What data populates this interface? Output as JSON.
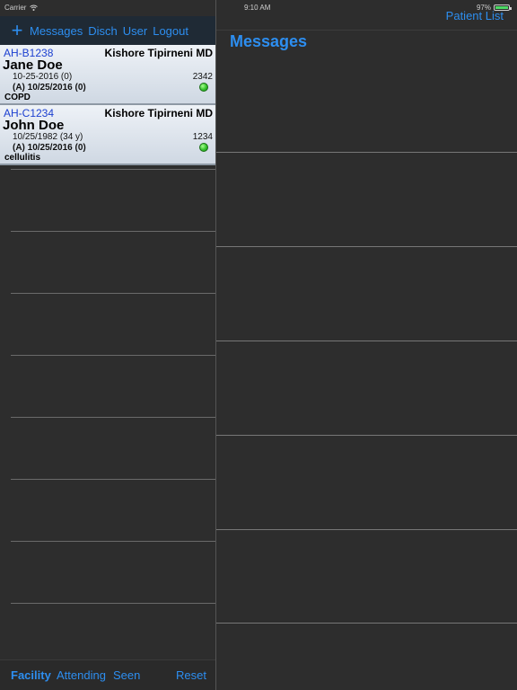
{
  "status_bar": {
    "carrier": "Carrier",
    "time": "9:10 AM",
    "battery": "97%",
    "battery_level": 0.97
  },
  "left_nav": {
    "add_icon": "plus-icon",
    "items": [
      "Messages",
      "Disch",
      "User",
      "Logout"
    ]
  },
  "patients": [
    {
      "id": "AH-B1238",
      "doctor": "Kishore Tipirneni MD",
      "name": "Jane Doe",
      "dob": "10-25-2016 (0)",
      "number": "2342",
      "admit": "(A)  10/25/2016 (0)",
      "diagnosis": "COPD",
      "status_color": "#36c22c"
    },
    {
      "id": "AH-C1234",
      "doctor": "Kishore Tipirneni MD",
      "name": "John Doe",
      "dob": "10/25/1982 (34 y)",
      "number": "1234",
      "admit": "(A)  10/25/2016 (0)",
      "diagnosis": "cellulitis",
      "status_color": "#36c22c"
    }
  ],
  "left_toolbar": {
    "facility": "Facility",
    "attending": "Attending",
    "seen": "Seen",
    "reset": "Reset"
  },
  "right_nav": {
    "patient_list": "Patient List",
    "title": "Messages"
  },
  "colors": {
    "accent": "#2d8ef0",
    "background": "#2d2d2d",
    "card_id": "#1b3fd0"
  }
}
